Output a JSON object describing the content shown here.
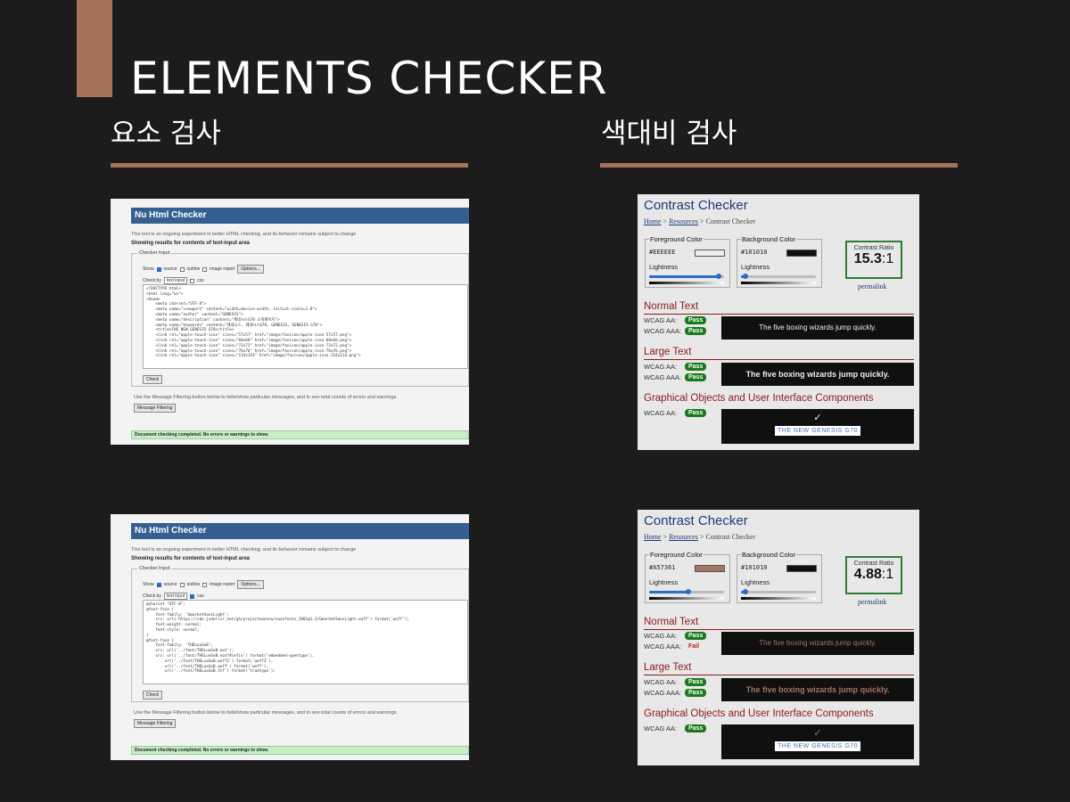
{
  "colors": {
    "background": "#1c1c1c",
    "accent": "#a57359",
    "text": "#ffffff"
  },
  "slide": {
    "title": "ELEMENTS CHECKER",
    "left_heading": "요소 검사",
    "right_heading": "색대비 검사"
  },
  "nu_checker": [
    {
      "header": "Nu Html Checker",
      "intro": "This tool is an ongoing experiment in better HTML checking, and its behavior remains subject to change",
      "showing": "Showing results for contents of text-input area",
      "legend": "Checker Input",
      "show_label": "Show",
      "show_options": [
        "source",
        "outline",
        "image report"
      ],
      "options_button": "Options...",
      "check_by_label": "Check by",
      "check_by_value": "text input",
      "css_label": "css",
      "code": [
        "<!DOCTYPE html>",
        "<html lang=\"en\">",
        "<head>",
        "    <meta charset=\"UTF-8\">",
        "    <meta name=\"viewport\" content=\"width=device-width, initial-scale=1.0\">",
        "    <meta name=\"author\" content=\"GENESIS\">",
        "    <meta name=\"description\" content=\"제네시스G70 소개페이지\">",
        "    <meta name=\"keywords\" content=\"제네시스, 제네시스G70, GENESIS, GENESIS G70\">",
        "    <title>THE NEW GENESIS G70</title>",
        "",
        "    <link rel=\"apple-touch-icon\" sizes=\"57x57\" href=\"image/favicon/apple-icon-57x57.png\">",
        "    <link rel=\"apple-touch-icon\" sizes=\"60x60\" href=\"image/favicon/apple-icon-60x60.png\">",
        "    <link rel=\"apple-touch-icon\" sizes=\"72x72\" href=\"image/favicon/apple-icon-72x72.png\">",
        "    <link rel=\"apple-touch-icon\" sizes=\"76x76\" href=\"image/favicon/apple-icon-76x76.png\">",
        "    <link rel=\"apple-touch-icon\" sizes=\"114x114\" href=\"image/favicon/apple-icon-114x114.png\">"
      ],
      "check_button": "Check",
      "filter_text": "Use the Message Filtering button below to hide/show particular messages, and to see total counts of errors and warnings.",
      "filter_button": "Message Filtering",
      "result": "Document checking completed. No errors or warnings to show."
    },
    {
      "header": "Nu Html Checker",
      "intro": "This tool is an ongoing experiment in better HTML checking, and its behavior remains subject to change",
      "showing": "Showing results for contents of text-input area",
      "legend": "Checker Input",
      "show_label": "Show",
      "show_options": [
        "source",
        "outline",
        "image report"
      ],
      "options_button": "Options...",
      "check_by_label": "Check by",
      "check_by_value": "text input",
      "css_label": "css",
      "code": [
        "@charset \"UTF-8\";",
        "",
        "@font-face {",
        "    font-family: 'GmarketSansLight';",
        "    src: url('https://cdn.jsdelivr.net/gh/projectnoonnu/noonfonts_2001@1.1/GmarketSansLight.woff') format('woff');",
        "    font-weight: normal;",
        "    font-style: normal;",
        "}",
        "@font-face {",
        "    font-family: 'THELuxGoB';",
        "    src: url('../font/THELuxGoB.eot');",
        "    src: url('../font/THELuxGoB.eot?#iefix') format('embedded-opentype'),",
        "        url('../font/THELuxGoB.woff2') format('woff2'),",
        "        url('../font/THELuxGoB.woff') format('woff'),",
        "        url('../font/THELuxGoB.ttf') format('truetype');"
      ],
      "check_button": "Check",
      "filter_text": "Use the Message Filtering button below to hide/show particular messages, and to see total counts of errors and warnings.",
      "filter_button": "Message Filtering",
      "result": "Document checking completed. No errors or warnings to show."
    }
  ],
  "contrast_checker": [
    {
      "title": "Contrast Checker",
      "crumb_home": "Home",
      "crumb_sep": " > ",
      "crumb_resources": "Resources",
      "crumb_current": "Contrast Checker",
      "fg_label": "Foreground Color",
      "fg_hex": "#EEEEEE",
      "fg_color": "#eeeeee",
      "fg_lightness_pct": 93,
      "bg_label": "Background Color",
      "bg_hex": "#101010",
      "bg_color": "#101010",
      "bg_lightness_pct": 6,
      "lightness_label": "Lightness",
      "ratio_label": "Contrast Ratio",
      "ratio_value": "15.3",
      "ratio_suffix": ":1",
      "permalink": "permalink",
      "normal_heading": "Normal Text",
      "large_heading": "Large Text",
      "graphical_heading": "Graphical Objects and User Interface Components",
      "aa_label": "WCAG AA:",
      "aaa_label": "WCAG AAA:",
      "normal_aa": "Pass",
      "normal_aaa": "Pass",
      "large_aa": "Pass",
      "large_aaa": "Pass",
      "graphical_aa": "Pass",
      "sample_normal": "The five boxing wizards jump quickly.",
      "sample_large": "The five boxing wizards jump quickly.",
      "check_glyph": "✓",
      "logo_text": "THE NEW GENESIS G70"
    },
    {
      "title": "Contrast Checker",
      "crumb_home": "Home",
      "crumb_sep": " > ",
      "crumb_resources": "Resources",
      "crumb_current": "Contrast Checker",
      "fg_label": "Foreground Color",
      "fg_hex": "#A57361",
      "fg_color": "#a57361",
      "fg_lightness_pct": 52,
      "bg_label": "Background Color",
      "bg_hex": "#101010",
      "bg_color": "#101010",
      "bg_lightness_pct": 6,
      "lightness_label": "Lightness",
      "ratio_label": "Contrast Ratio",
      "ratio_value": "4.88",
      "ratio_suffix": ":1",
      "permalink": "permalink",
      "normal_heading": "Normal Text",
      "large_heading": "Large Text",
      "graphical_heading": "Graphical Objects and User Interface Components",
      "aa_label": "WCAG AA:",
      "aaa_label": "WCAG AAA:",
      "normal_aa": "Pass",
      "normal_aaa": "Fail",
      "large_aa": "Pass",
      "large_aaa": "Pass",
      "graphical_aa": "Pass",
      "sample_normal": "The five boxing wizards jump quickly.",
      "sample_large": "The five boxing wizards jump quickly.",
      "check_glyph": "✓",
      "logo_text": "THE NEW GENESIS G70"
    }
  ]
}
